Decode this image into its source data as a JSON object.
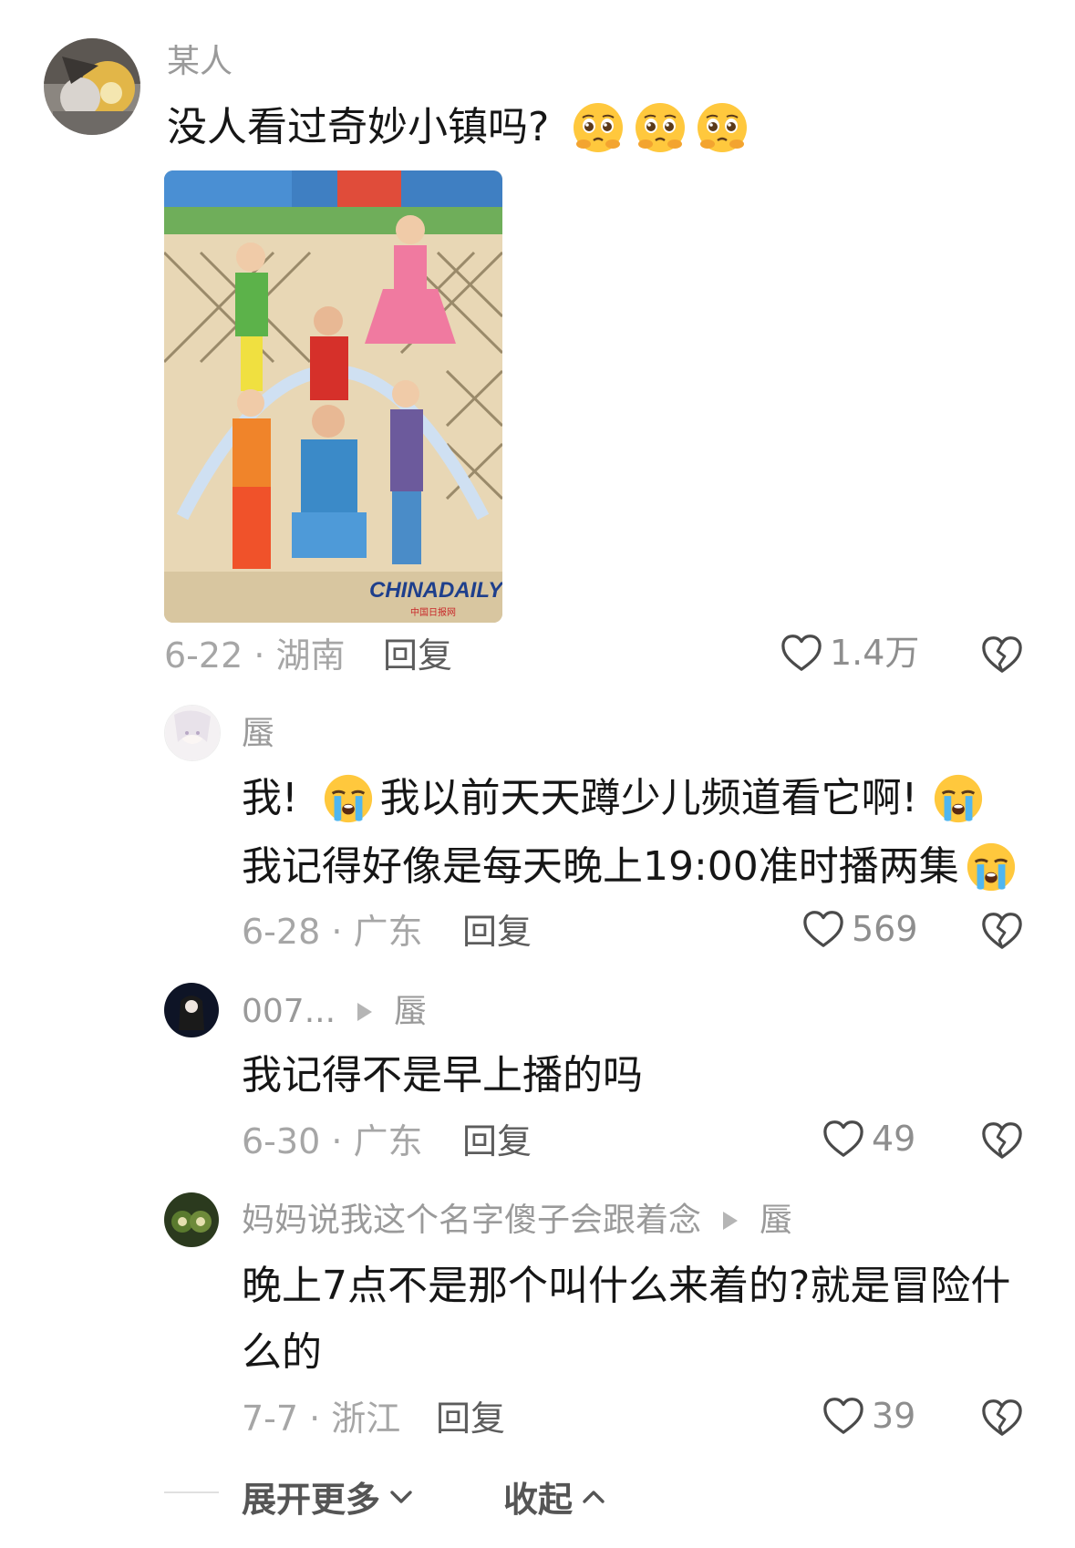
{
  "comment1": {
    "user": "某人",
    "text": "没人看过奇妙小镇吗?",
    "emojis": [
      "pleading-face",
      "pleading-face",
      "pleading-face"
    ],
    "image_watermark": "CHINADAILY",
    "image_watermark_sub": "中国日报网",
    "date_loc": "6-22 · 湖南",
    "reply_label": "回复",
    "likes": "1.4万"
  },
  "comment2": {
    "user": "蜃",
    "line1_a": "我!",
    "line1_b": "我以前天天蹲少儿频道看它啊!",
    "line2": "我记得好像是每天晚上19:00准时播两集",
    "date_loc": "6-28 · 广东",
    "reply_label": "回复",
    "likes": "569"
  },
  "comment3": {
    "user": "007...",
    "reply_to": "蜃",
    "text": "我记得不是早上播的吗",
    "date_loc": "6-30 · 广东",
    "reply_label": "回复",
    "likes": "49"
  },
  "comment4": {
    "user": "妈妈说我这个名字傻子会跟着念",
    "reply_to": "蜃",
    "line1": "晚上7点不是那个叫什么来着的?就是冒险什",
    "line2": "么的",
    "date_loc": "7-7 · 浙江",
    "reply_label": "回复",
    "likes": "39"
  },
  "footer": {
    "expand_label": "展开更多",
    "collapse_label": "收起"
  }
}
